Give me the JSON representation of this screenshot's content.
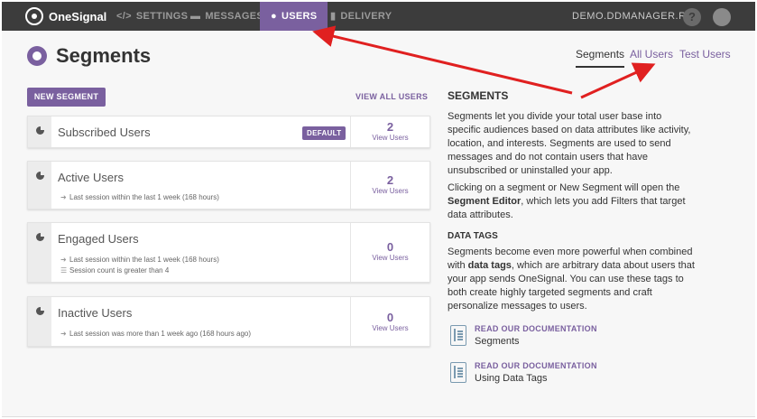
{
  "app": {
    "name": "OneSignal"
  },
  "nav": {
    "items": [
      {
        "label": "SETTINGS",
        "icon": "code-icon"
      },
      {
        "label": "MESSAGES",
        "icon": "chat-icon"
      },
      {
        "label": "USERS",
        "icon": "users-icon",
        "active": true
      },
      {
        "label": "DELIVERY",
        "icon": "bar-chart-icon"
      }
    ],
    "site": "DEMO.DDMANAGER.RU",
    "help_label": "?"
  },
  "page": {
    "title": "Segments",
    "tabs": [
      {
        "label": "Segments",
        "active": true
      },
      {
        "label": "All Users"
      },
      {
        "label": "Test Users"
      }
    ],
    "new_segment_label": "NEW SEGMENT",
    "view_all_label": "VIEW ALL USERS"
  },
  "segments": [
    {
      "name": "Subscribed Users",
      "badge": "DEFAULT",
      "count": "2",
      "count_label": "View Users",
      "filters": []
    },
    {
      "name": "Active Users",
      "count": "2",
      "count_label": "View Users",
      "filters": [
        "Last session within the last 1 week (168 hours)"
      ]
    },
    {
      "name": "Engaged Users",
      "count": "0",
      "count_label": "View Users",
      "filters": [
        "Last session within the last 1 week (168 hours)",
        "Session count is greater than 4"
      ]
    },
    {
      "name": "Inactive Users",
      "count": "0",
      "count_label": "View Users",
      "filters": [
        "Last session was more than 1 week ago (168 hours ago)"
      ]
    }
  ],
  "info": {
    "heading": "SEGMENTS",
    "p1": "Segments let you divide your total user base into specific audiences based on data attributes like activity, location, and interests. Segments are used to send messages and do not contain users that have unsubscribed or uninstalled your app.",
    "p2_a": "Clicking on a segment or New Segment will open the ",
    "p2_b": "Segment Editor",
    "p2_c": ", which lets you add Filters that target data attributes.",
    "tags_heading": "DATA TAGS",
    "p3_a": "Segments become even more powerful when combined with ",
    "p3_b": "data tags",
    "p3_c": ", which are arbitrary data about users that your app sends OneSignal. You can use these tags to both create highly targeted segments and craft personalize messages to users.",
    "docs": [
      {
        "link": "READ OUR DOCUMENTATION",
        "title": "Segments"
      },
      {
        "link": "READ OUR DOCUMENTATION",
        "title": "Using Data Tags"
      }
    ]
  },
  "colors": {
    "accent": "#7a609f",
    "topbar": "#3c3c3c",
    "annotation": "#e02020"
  }
}
